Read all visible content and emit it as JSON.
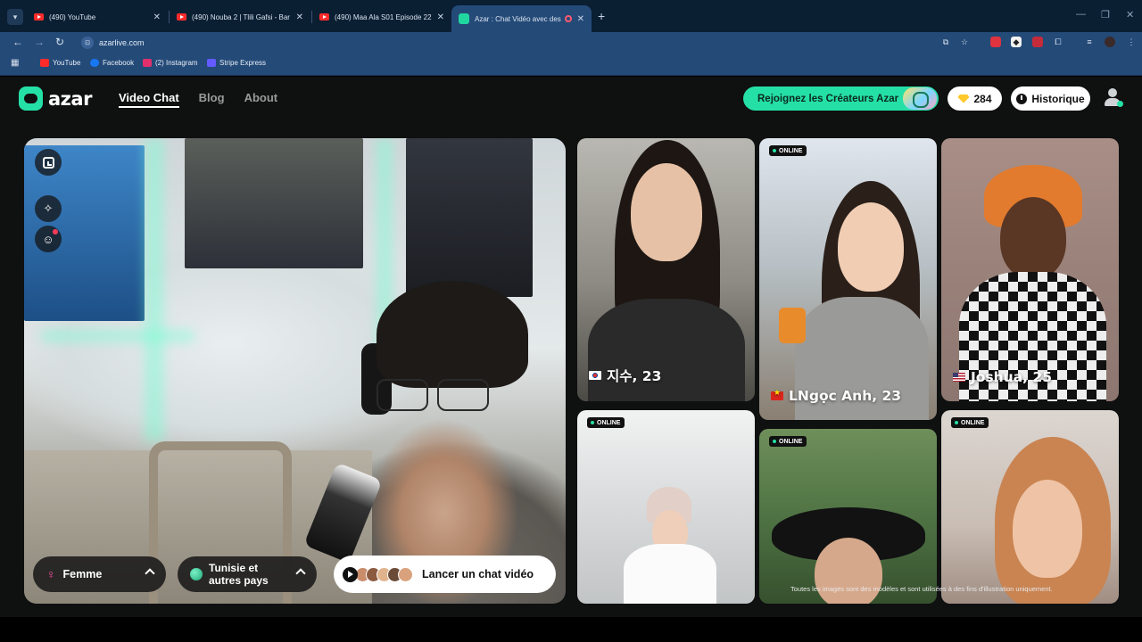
{
  "browser": {
    "tabs": [
      {
        "title": "(490) YouTube",
        "active": false
      },
      {
        "title": "(490) Nouba 2 | Tlili Gafsi - Bar",
        "active": false
      },
      {
        "title": "(490) Maa Ala S01 Episode 22 (",
        "active": false
      },
      {
        "title": "Azar : Chat Vidéo avec des",
        "active": true
      }
    ],
    "url": "azarlive.com",
    "bookmarks": [
      {
        "label": "YouTube",
        "color": "#ff2b2b"
      },
      {
        "label": "Facebook",
        "color": "#1877f2"
      },
      {
        "label": "(2) Instagram",
        "color": "#e1306c"
      },
      {
        "label": "Stripe Express",
        "color": "#635bff"
      }
    ]
  },
  "header": {
    "logo": "azar",
    "nav": [
      {
        "label": "Video Chat",
        "active": true
      },
      {
        "label": "Blog",
        "active": false
      },
      {
        "label": "About",
        "active": false
      }
    ],
    "creators_button": "Rejoignez les Créateurs Azar",
    "gems_count": "284",
    "history_button": "Historique"
  },
  "controls": {
    "gender_filter": "Femme",
    "country_filter_line1": "Tunisie et",
    "country_filter_line2": "autres pays",
    "start_button": "Lancer un chat vidéo",
    "icons": [
      "expand-icon",
      "magic-wand-icon",
      "smiley-icon"
    ]
  },
  "profiles": [
    {
      "name": "지수, 23",
      "flag": "kr",
      "online": false
    },
    {
      "name": "LNgọc Anh, 23",
      "flag": "vn",
      "online": true
    },
    {
      "name": "Joshua, 25",
      "flag": "us",
      "online": false
    },
    {
      "name": "",
      "flag": "",
      "online": true
    },
    {
      "name": "",
      "flag": "",
      "online": true
    },
    {
      "name": "",
      "flag": "",
      "online": true
    }
  ],
  "online_label": "ONLINE",
  "disclaimer": "Toutes les images sont des modèles et sont utilisées à des fins d'illustration uniquement.",
  "colors": {
    "accent": "#25e0a6",
    "background": "#0f1010",
    "browser_frame": "#244a78"
  }
}
